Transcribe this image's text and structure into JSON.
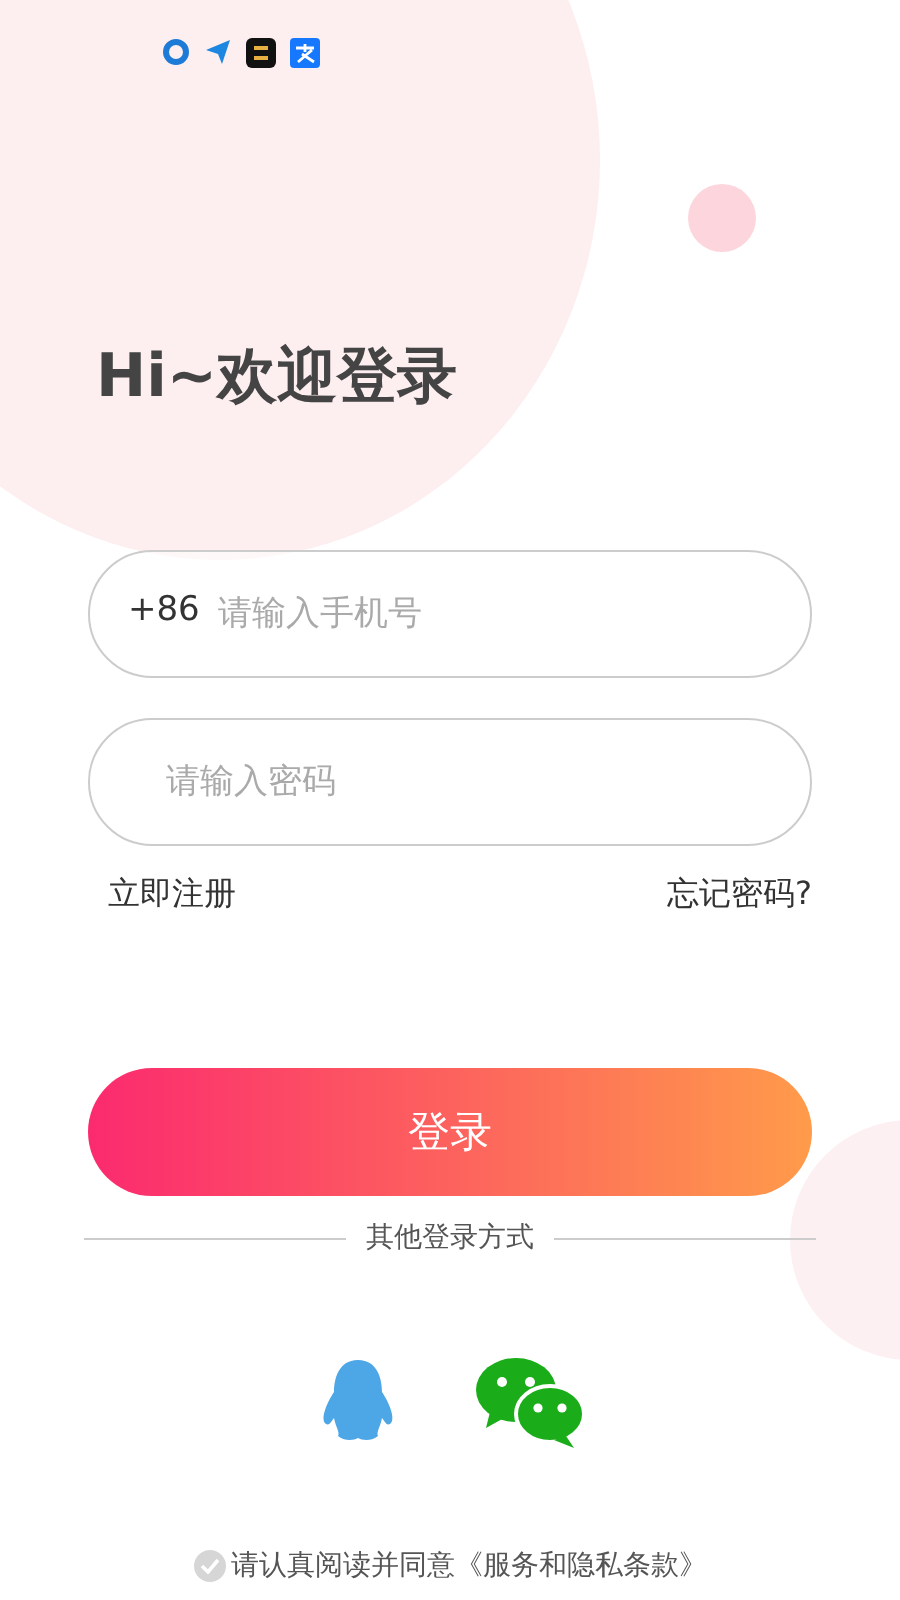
{
  "title": "Hi~欢迎登录",
  "phone": {
    "prefix": "+86",
    "placeholder": "请输入手机号"
  },
  "password": {
    "placeholder": "请输入密码"
  },
  "links": [
    "立即注册",
    "忘记密码?"
  ],
  "login_button": "登录",
  "other_login": {
    "label": "其他登录方式",
    "methods": [
      {
        "kind": "qq"
      },
      {
        "kind": "wechat"
      }
    ]
  },
  "agreement": {
    "agreed": false,
    "text": "请认真阅读并同意《服务和隐私条款》"
  }
}
